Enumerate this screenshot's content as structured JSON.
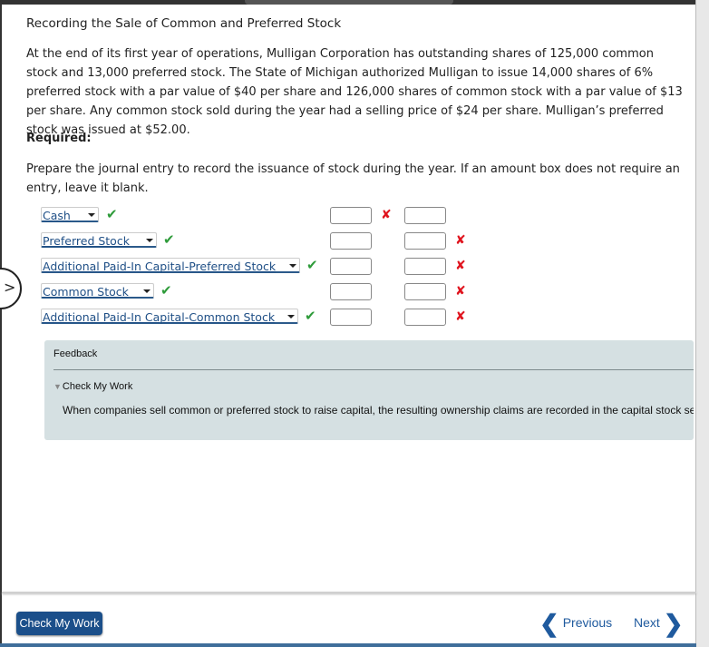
{
  "title": "Recording the Sale of Common and Preferred Stock",
  "problem_text": "At the end of its first year of operations, Mulligan Corporation has outstanding shares of 125,000 common stock and 13,000 preferred stock. The State of Michigan authorized Mulligan to issue 14,000 shares of 6% preferred stock with a par value of $40 per share and 126,000 shares of common stock with a par value of $13 per share. Any common stock sold during the year had a selling price of $24 per share. Mulligan’s preferred stock was issued at $52.00.",
  "required_label": "Required:",
  "instructions": "Prepare the journal entry to record the issuance of stock during the year. If an amount box does not require an entry, leave it blank.",
  "journal_rows": [
    {
      "account": "Cash",
      "account_status": "correct",
      "debit": "",
      "debit_status": "incorrect",
      "credit": "",
      "credit_status": "none"
    },
    {
      "account": "Preferred Stock",
      "account_status": "correct",
      "debit": "",
      "debit_status": "none",
      "credit": "",
      "credit_status": "incorrect"
    },
    {
      "account": "Additional Paid-In Capital-Preferred Stock",
      "account_status": "correct",
      "debit": "",
      "debit_status": "none",
      "credit": "",
      "credit_status": "incorrect"
    },
    {
      "account": "Common Stock",
      "account_status": "correct",
      "debit": "",
      "debit_status": "none",
      "credit": "",
      "credit_status": "incorrect"
    },
    {
      "account": "Additional Paid-In Capital-Common Stock",
      "account_status": "correct",
      "debit": "",
      "debit_status": "none",
      "credit": "",
      "credit_status": "incorrect"
    }
  ],
  "icons": {
    "check": "✔",
    "cross": "✘"
  },
  "feedback": {
    "title": "Feedback",
    "toggle_label": "Check My Work",
    "text": "When companies sell common or preferred stock to raise capital, the resulting ownership claims are recorded in the capital stock se"
  },
  "footer": {
    "check_button": "Check My Work",
    "previous": "Previous",
    "next": "Next"
  },
  "colors": {
    "accent": "#1b4f8a",
    "correct": "#2e9b3a",
    "incorrect": "#e0141e",
    "feedback_bg": "#d5e0e2"
  }
}
